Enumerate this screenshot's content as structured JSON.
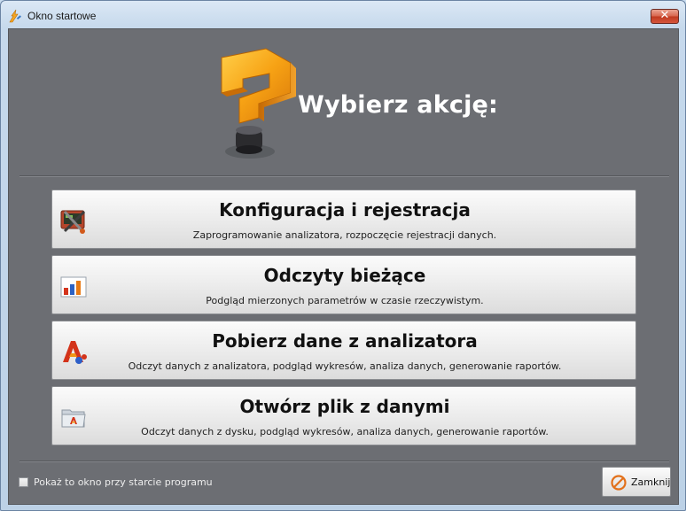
{
  "window": {
    "title": "Okno startowe",
    "close_glyph": "✕",
    "app_icon": "lightning-wrench-icon"
  },
  "header": {
    "heading": "Wybierz akcję:",
    "logo": "question-mark-logo"
  },
  "actions": [
    {
      "title": "Konfiguracja i rejestracja",
      "description": "Zaprogramowanie analizatora, rozpoczęcie rejestracji danych.",
      "icon": "device-config-icon"
    },
    {
      "title": "Odczyty bieżące",
      "description": "Podgląd mierzonych parametrów w czasie rzeczywistym.",
      "icon": "bar-chart-icon"
    },
    {
      "title": "Pobierz dane z analizatora",
      "description": "Odczyt danych z analizatora, podgląd wykresów, analiza danych, generowanie raportów.",
      "icon": "analyzer-download-icon"
    },
    {
      "title": "Otwórz plik z danymi",
      "description": "Odczyt danych z dysku, podgląd wykresów, analiza danych, generowanie raportów.",
      "icon": "open-folder-icon"
    }
  ],
  "footer": {
    "startup_checkbox_label": "Pokaż to okno przy starcie programu",
    "startup_checkbox_checked": false,
    "close_button_label": "Zamknij",
    "close_button_icon": "stop-icon"
  },
  "colors": {
    "background": "#6c6e73",
    "heading": "#ffffff",
    "accent_orange": "#f39a12"
  }
}
